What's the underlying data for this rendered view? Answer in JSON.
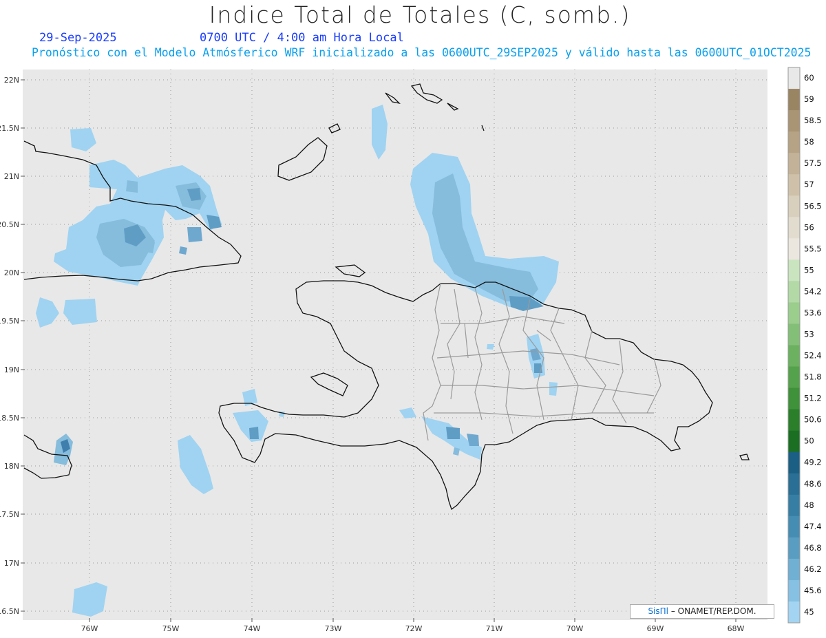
{
  "header": {
    "title": "Indice Total de Totales (C, somb.)",
    "date": "29-Sep-2025",
    "time": "0700 UTC / 4:00 am Hora Local",
    "forecast": "Pronóstico con el Modelo Atmósferico WRF inicializado a las 0600UTC_29SEP2025 y válido hasta las  0600UTC_01OCT2025"
  },
  "map": {
    "lat_labels": [
      "22N",
      "21.5N",
      "21N",
      "20.5N",
      "20N",
      "19.5N",
      "19N",
      "18.5N",
      "18N",
      "17.5N",
      "17N",
      "16.5N"
    ],
    "lon_labels": [
      "76W",
      "75W",
      "74W",
      "73W",
      "72W",
      "71W",
      "70W",
      "69W",
      "68W"
    ],
    "background_color": "#e8e8e8"
  },
  "colorbar": {
    "levels": [
      {
        "label": "60",
        "color": "#e8e8e8"
      },
      {
        "label": "59",
        "color": "#9a8563"
      },
      {
        "label": "58.5",
        "color": "#a99474"
      },
      {
        "label": "58",
        "color": "#b6a385"
      },
      {
        "label": "57.5",
        "color": "#c3b297"
      },
      {
        "label": "57",
        "color": "#cfc1a9"
      },
      {
        "label": "56.5",
        "color": "#d9cfbd"
      },
      {
        "label": "56",
        "color": "#e2dccf"
      },
      {
        "label": "55.5",
        "color": "#ebe7df"
      },
      {
        "label": "55",
        "color": "#c9e4bf"
      },
      {
        "label": "54.2",
        "color": "#b2d9a6"
      },
      {
        "label": "53.6",
        "color": "#9bcd8d"
      },
      {
        "label": "53",
        "color": "#83bf76"
      },
      {
        "label": "52.4",
        "color": "#6bb160"
      },
      {
        "label": "51.8",
        "color": "#55a24c"
      },
      {
        "label": "51.2",
        "color": "#3f913a"
      },
      {
        "label": "50.6",
        "color": "#2b7f2b"
      },
      {
        "label": "50",
        "color": "#1a6f22"
      },
      {
        "label": "49.2",
        "color": "#1c5f85"
      },
      {
        "label": "48.6",
        "color": "#2a6f95"
      },
      {
        "label": "48",
        "color": "#377ea5"
      },
      {
        "label": "47.4",
        "color": "#468db4"
      },
      {
        "label": "46.8",
        "color": "#5a9dc3"
      },
      {
        "label": "46.2",
        "color": "#6fb0d3"
      },
      {
        "label": "45.6",
        "color": "#86c1e3"
      },
      {
        "label": "45",
        "color": "#a3d4f2"
      }
    ]
  },
  "credit": {
    "brand": "SisПl",
    "text": "– ONAMET/REP.DOM."
  },
  "fill_colors": {
    "light": "#9fd3f1",
    "medium": "#86bcdc",
    "dark": "#5f9dc5",
    "darkest": "#3f7fae"
  }
}
